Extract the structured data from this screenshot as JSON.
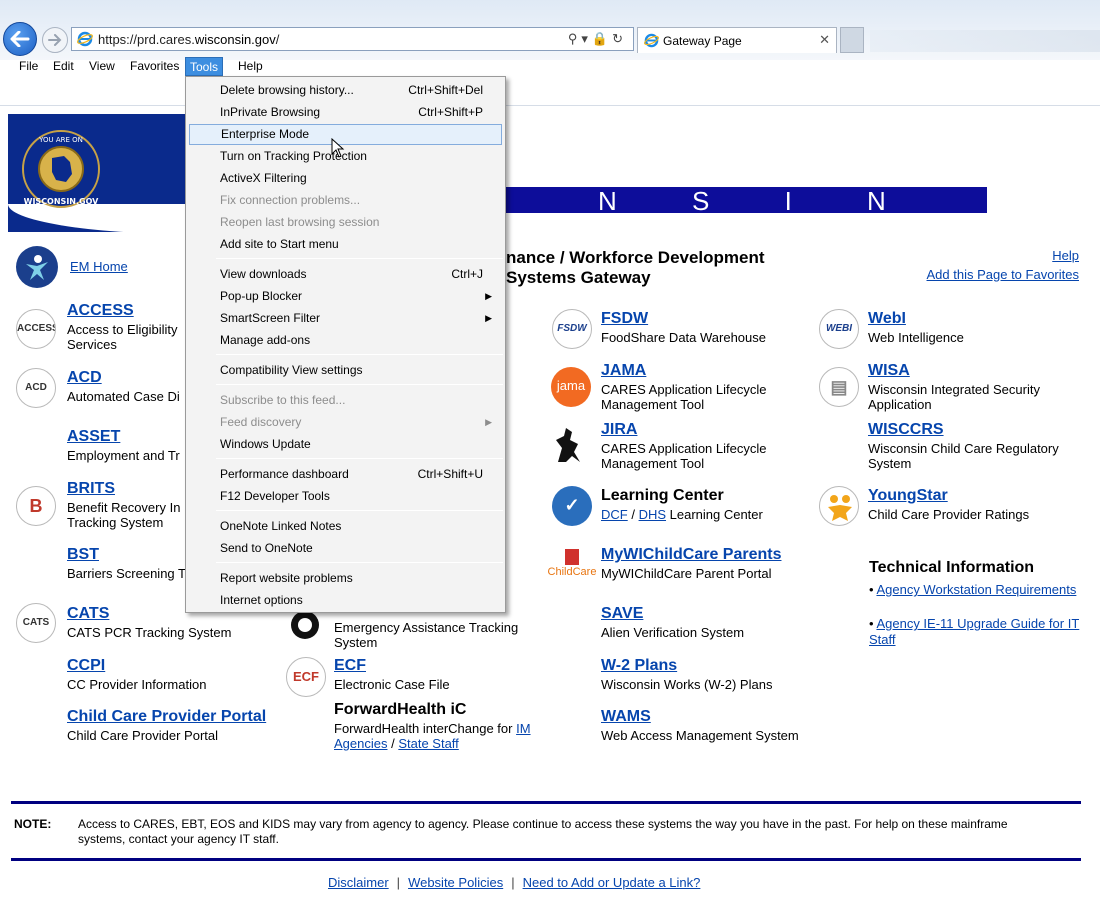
{
  "browser": {
    "url_prefix": "https://prd.cares.",
    "url_domain": "wisconsin.gov",
    "url_suffix": "/",
    "tab_title": "Gateway Page",
    "menu": [
      "File",
      "Edit",
      "View",
      "Favorites",
      "Tools",
      "Help"
    ],
    "active_menu": "Tools"
  },
  "tools_menu": {
    "items": [
      {
        "label": "Delete browsing history...",
        "shortcut": "Ctrl+Shift+Del"
      },
      {
        "label": "InPrivate Browsing",
        "shortcut": "Ctrl+Shift+P"
      },
      {
        "label": "Enterprise Mode"
      },
      {
        "label": "Turn on Tracking Protection"
      },
      {
        "label": "ActiveX Filtering"
      },
      {
        "label": "Fix connection problems..."
      },
      {
        "label": "Reopen last browsing session"
      },
      {
        "label": "Add site to Start menu"
      },
      {
        "label": "View downloads",
        "shortcut": "Ctrl+J"
      },
      {
        "label": "Pop-up Blocker"
      },
      {
        "label": "SmartScreen Filter"
      },
      {
        "label": "Manage add-ons"
      },
      {
        "label": "Compatibility View settings"
      },
      {
        "label": "Subscribe to this feed..."
      },
      {
        "label": "Feed discovery"
      },
      {
        "label": "Windows Update"
      },
      {
        "label": "Performance dashboard",
        "shortcut": "Ctrl+Shift+U"
      },
      {
        "label": "F12 Developer Tools"
      },
      {
        "label": "OneNote Linked Notes"
      },
      {
        "label": "Send to OneNote"
      },
      {
        "label": "Report website problems"
      },
      {
        "label": "Internet options"
      }
    ]
  },
  "header": {
    "seal_text": "YOU ARE ON WISCONSIN.GOV",
    "bar_letters": "N S I N",
    "em_home": "EM Home",
    "title_line1": "nance / Workforce Development",
    "title_line2": "Systems Gateway",
    "help": "Help",
    "favorites": "Add this Page to Favorites"
  },
  "col1": [
    {
      "name": "ACCESS",
      "desc": "Access to Eligibility",
      "desc2": "Services",
      "icon": "ACCESS"
    },
    {
      "name": "ACD",
      "desc": "Automated Case Di",
      "icon": "ACD"
    },
    {
      "name": "ASSET",
      "desc": "Employment and Tr"
    },
    {
      "name": "BRITS",
      "desc": "Benefit Recovery In",
      "desc2": "Tracking System",
      "icon": "B"
    },
    {
      "name": "BST",
      "desc": "Barriers Screening T"
    },
    {
      "name": "CATS",
      "desc": "CATS PCR Tracking System",
      "icon": "CATS"
    },
    {
      "name": "CCPI",
      "desc": "CC Provider Information"
    },
    {
      "name": "Child Care Provider Portal",
      "desc": "Child Care Provider Portal"
    }
  ],
  "col2": [
    {
      "name": "",
      "desc": "Emergency Assistance Tracking",
      "desc2": "System"
    },
    {
      "name": "ECF",
      "desc": "Electronic Case File",
      "icon": "ECF"
    },
    {
      "name": "ForwardHealth iC",
      "desc": "ForwardHealth interChange for ",
      "link1": "IM Agencies",
      "sep": " / ",
      "link2": "State Staff"
    }
  ],
  "col3": [
    {
      "name": "FSDW",
      "desc": "FoodShare Data Warehouse",
      "icon": "FSDW"
    },
    {
      "name": "JAMA",
      "desc": "CARES Application Lifecycle",
      "desc2": "Management Tool",
      "icon": "jama"
    },
    {
      "name": "JIRA",
      "desc": "CARES Application Lifecycle",
      "desc2": "Management Tool"
    },
    {
      "name": "Learning Center",
      "link1": "DCF",
      "sep": " / ",
      "link2": "DHS",
      "desc": " Learning Center"
    },
    {
      "name": "MyWIChildCare Parents",
      "desc": "MyWIChildCare Parent Portal",
      "icon": "ChildCare"
    },
    {
      "name": "SAVE",
      "desc": "Alien Verification System"
    },
    {
      "name": "W-2 Plans",
      "desc": "Wisconsin Works (W-2) Plans"
    },
    {
      "name": "WAMS",
      "desc": "Web Access Management System"
    }
  ],
  "col4": [
    {
      "name": "WebI",
      "desc": "Web Intelligence",
      "icon": "WEBI"
    },
    {
      "name": "WISA",
      "desc": "Wisconsin Integrated Security",
      "desc2": "Application"
    },
    {
      "name": "WISCCRS",
      "desc": "Wisconsin Child Care Regulatory",
      "desc2": "System"
    },
    {
      "name": "YoungStar",
      "desc": "Child Care Provider Ratings"
    }
  ],
  "tech": {
    "heading": "Technical Information",
    "items": [
      "Agency Workstation Requirements",
      "Agency IE-11 Upgrade Guide for IT Staff"
    ]
  },
  "note": {
    "label": "NOTE:",
    "text": "Access to CARES, EBT, EOS and KIDS may vary from agency to agency. Please continue to access these systems the way you have in the past. For help on these mainframe systems, contact your agency IT staff."
  },
  "footer": {
    "links": [
      "Disclaimer",
      "Website Policies",
      "Need to Add or Update a Link?"
    ],
    "sep": "|"
  }
}
